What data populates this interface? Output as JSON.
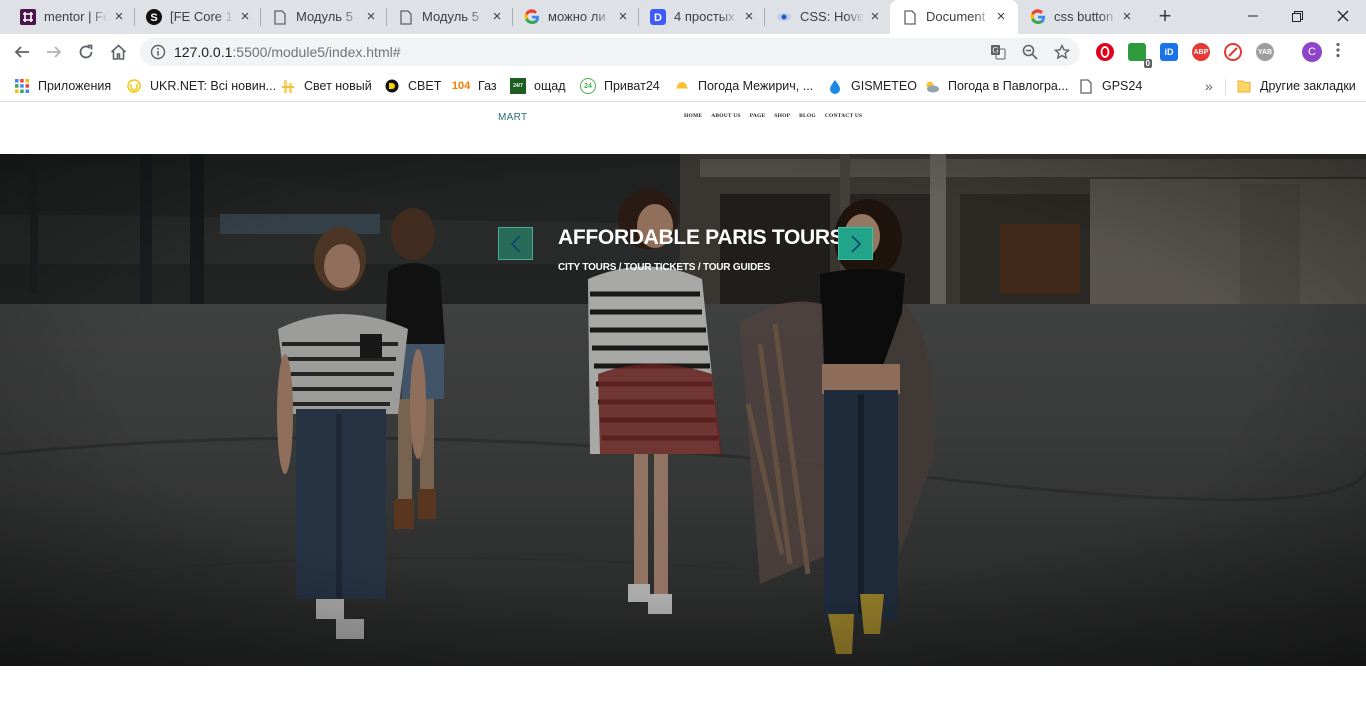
{
  "tabs": [
    {
      "title": "mentor | Fe",
      "icon": "slack-icon"
    },
    {
      "title": "[FE Core 13",
      "icon": "skype-icon"
    },
    {
      "title": "Модуль 5",
      "icon": "page-icon"
    },
    {
      "title": "Модуль 5",
      "icon": "page-icon"
    },
    {
      "title": "можно ли",
      "icon": "google-icon"
    },
    {
      "title": "4 простых",
      "icon": "d-icon"
    },
    {
      "title": "CSS: Hover",
      "icon": "eye-icon"
    },
    {
      "title": "Document",
      "icon": "page-icon",
      "active": true
    },
    {
      "title": "css button",
      "icon": "google-icon"
    }
  ],
  "address_bar": {
    "url_host": "127.0.0.1",
    "url_rest": ":5500/module5/index.html#"
  },
  "profile_initial": "С",
  "bookmarks": [
    {
      "label": "Приложения",
      "icon": "apps-icon"
    },
    {
      "label": "UKR.NET: Всі новин...",
      "icon": "ukrnet-icon"
    },
    {
      "label": "Свет новый",
      "icon": "bulb-icon"
    },
    {
      "label": "СВЕТ",
      "icon": "d-logo-icon"
    },
    {
      "label": "Газ",
      "icon": "gas-104-icon",
      "icon_text": "104"
    },
    {
      "label": "ощад",
      "icon": "oschad-icon",
      "icon_text": "24/7"
    },
    {
      "label": "Приват24",
      "icon": "privat24-icon",
      "icon_text": "24"
    },
    {
      "label": "Погода Межирич, ...",
      "icon": "weather-sun-icon"
    },
    {
      "label": "GISMETEO",
      "icon": "drop-icon"
    },
    {
      "label": "Погода в Павлогра...",
      "icon": "weather-cloud-icon"
    },
    {
      "label": "GPS24",
      "icon": "page-icon"
    }
  ],
  "bookmarks_overflow": "»",
  "other_bookmarks": "Другие закладки",
  "extensions": [
    {
      "name": "opera-icon",
      "color": "#e0001b",
      "text": ""
    },
    {
      "name": "puzzle-badge-icon",
      "color": "#2e9c3c",
      "text": "0"
    },
    {
      "name": "id-icon",
      "color": "#1a73e8",
      "text": "iD"
    },
    {
      "name": "adblock-plus-icon",
      "color": "#e53935",
      "text": "ABP"
    },
    {
      "name": "block-icon",
      "color": "#e53935",
      "text": ""
    },
    {
      "name": "yab-icon",
      "color": "#9e9e9e",
      "text": "YAB"
    }
  ],
  "site": {
    "logo": "MART",
    "nav": [
      "HOME",
      "ABOUT US",
      "PAGE",
      "SHOP",
      "BLOG",
      "CONTACT US"
    ],
    "hero": {
      "title": "AFFORDABLE PARIS TOURS",
      "subtitle": "CITY TOURS / TOUR TICKETS / TOUR GUIDES"
    }
  }
}
